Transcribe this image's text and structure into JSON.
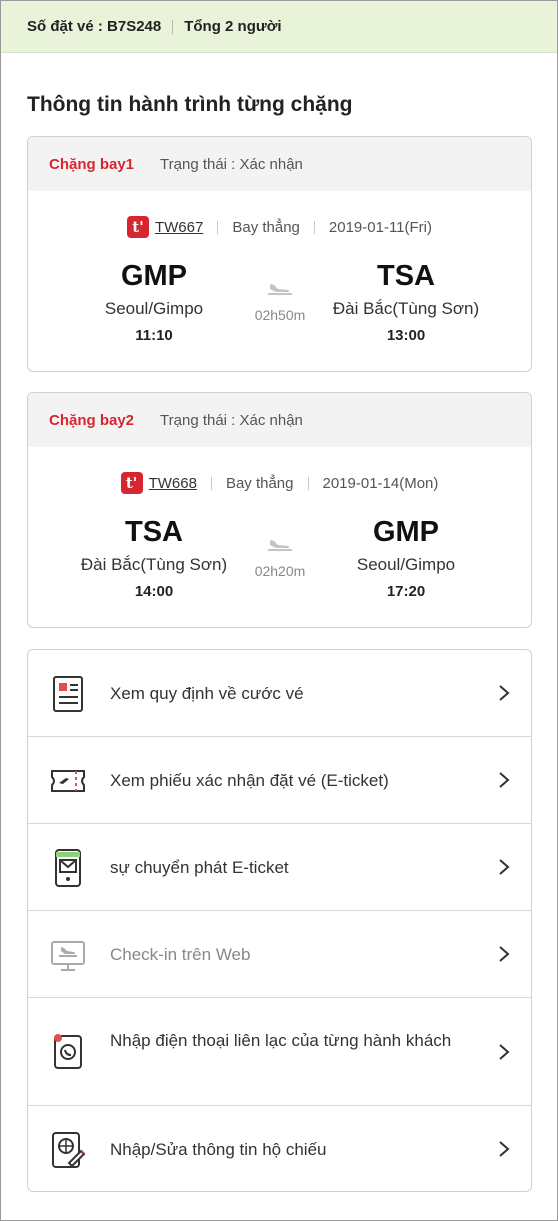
{
  "booking": {
    "number_label": "Số đặt vé : B7S248",
    "pax_label": "Tổng 2 người"
  },
  "section_title": "Thông tin hành trình từng chặng",
  "legs": [
    {
      "name": "Chặng bay1",
      "status": "Trạng thái : Xác nhận",
      "airline_logo": "t'",
      "flight_no": "TW667",
      "type": "Bay thẳng",
      "date": "2019-01-11(Fri)",
      "from": {
        "code": "GMP",
        "city": "Seoul/Gimpo",
        "time": "11:10"
      },
      "to": {
        "code": "TSA",
        "city": "Đài Bắc(Tùng Sơn)",
        "time": "13:00"
      },
      "duration": "02h50m"
    },
    {
      "name": "Chặng bay2",
      "status": "Trạng thái : Xác nhận",
      "airline_logo": "t'",
      "flight_no": "TW668",
      "type": "Bay thẳng",
      "date": "2019-01-14(Mon)",
      "from": {
        "code": "TSA",
        "city": "Đài Bắc(Tùng Sơn)",
        "time": "14:00"
      },
      "to": {
        "code": "GMP",
        "city": "Seoul/Gimpo",
        "time": "17:20"
      },
      "duration": "02h20m"
    }
  ],
  "menu": [
    {
      "label": "Xem quy định về cước vé",
      "icon": "fare-rules-icon",
      "enabled": true
    },
    {
      "label": "Xem phiếu xác nhận đặt vé (E-ticket)",
      "icon": "ticket-icon",
      "enabled": true
    },
    {
      "label": "sự chuyển phát E-ticket",
      "icon": "mobile-mail-icon",
      "enabled": true
    },
    {
      "label": "Check-in trên Web",
      "icon": "web-checkin-icon",
      "enabled": false
    },
    {
      "label": "Nhập điện thoại liên lạc của từng hành khách",
      "icon": "contact-phone-icon",
      "enabled": true
    },
    {
      "label": "Nhập/Sửa thông tin hộ chiếu",
      "icon": "passport-edit-icon",
      "enabled": true
    }
  ],
  "colors": {
    "accent_red": "#d6262f",
    "header_bg": "#e9f3da",
    "leg_head_bg": "#f3f3f3"
  }
}
